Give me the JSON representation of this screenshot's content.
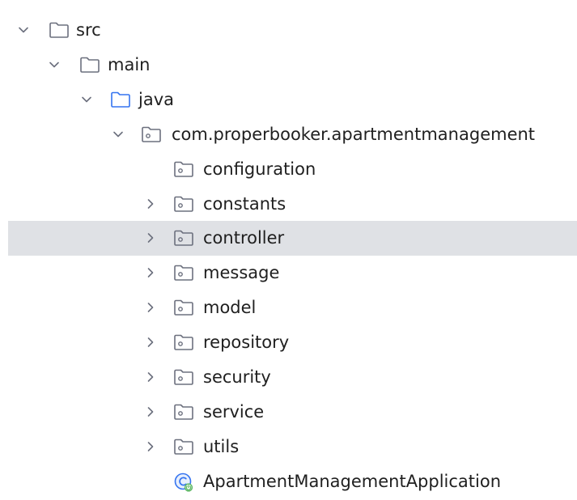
{
  "tree": {
    "src": "src",
    "main": "main",
    "java": "java",
    "package": "com.properbooker.apartmentmanagement",
    "folders": {
      "configuration": "configuration",
      "constants": "constants",
      "controller": "controller",
      "message": "message",
      "model": "model",
      "repository": "repository",
      "security": "security",
      "service": "service",
      "utils": "utils"
    },
    "app_class": "ApartmentManagementApplication"
  },
  "icons": {
    "folder": "folder-icon",
    "package": "package-folder-icon",
    "source_root": "source-root-folder-icon",
    "spring_class": "spring-boot-class-icon",
    "expanded": "chevron-down-icon",
    "collapsed": "chevron-right-icon"
  },
  "colors": {
    "selection": "#dfe1e5",
    "source_root_blue": "#3574f0",
    "icon_gray": "#6c707e",
    "text": "#1f1f1f"
  }
}
